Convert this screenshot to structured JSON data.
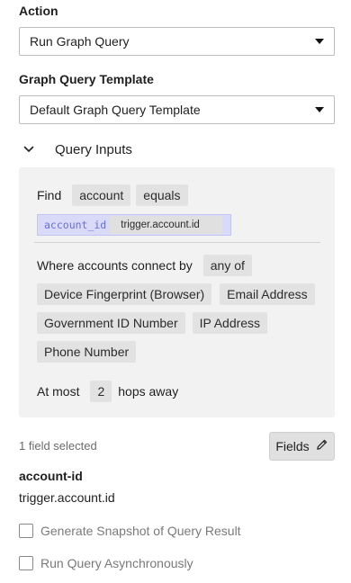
{
  "action": {
    "label": "Action",
    "selected": "Run Graph Query"
  },
  "template": {
    "label": "Graph Query Template",
    "selected": "Default Graph Query Template"
  },
  "query_inputs": {
    "title": "Query Inputs",
    "chevron_icon": "chevron-down-icon",
    "find_label": "Find",
    "find_entity": "account",
    "find_operator": "equals",
    "variable_name": "account_id",
    "variable_value": "trigger.account.id",
    "connect_label": "Where accounts connect by",
    "connect_mode": "any of",
    "connections": [
      "Device Fingerprint (Browser)",
      "Email Address",
      "Government ID Number",
      "IP Address",
      "Phone Number"
    ],
    "at_most_label": "At most",
    "hops_value": "2",
    "hops_label": "hops away"
  },
  "fields": {
    "count_text": "1 field selected",
    "button_label": "Fields",
    "button_icon": "pencil-icon",
    "field_key": "account-id",
    "field_value": "trigger.account.id"
  },
  "options": {
    "snapshot_label": "Generate Snapshot of Query Result",
    "snapshot_checked": false,
    "async_label": "Run Query Asynchronously",
    "async_checked": false
  }
}
